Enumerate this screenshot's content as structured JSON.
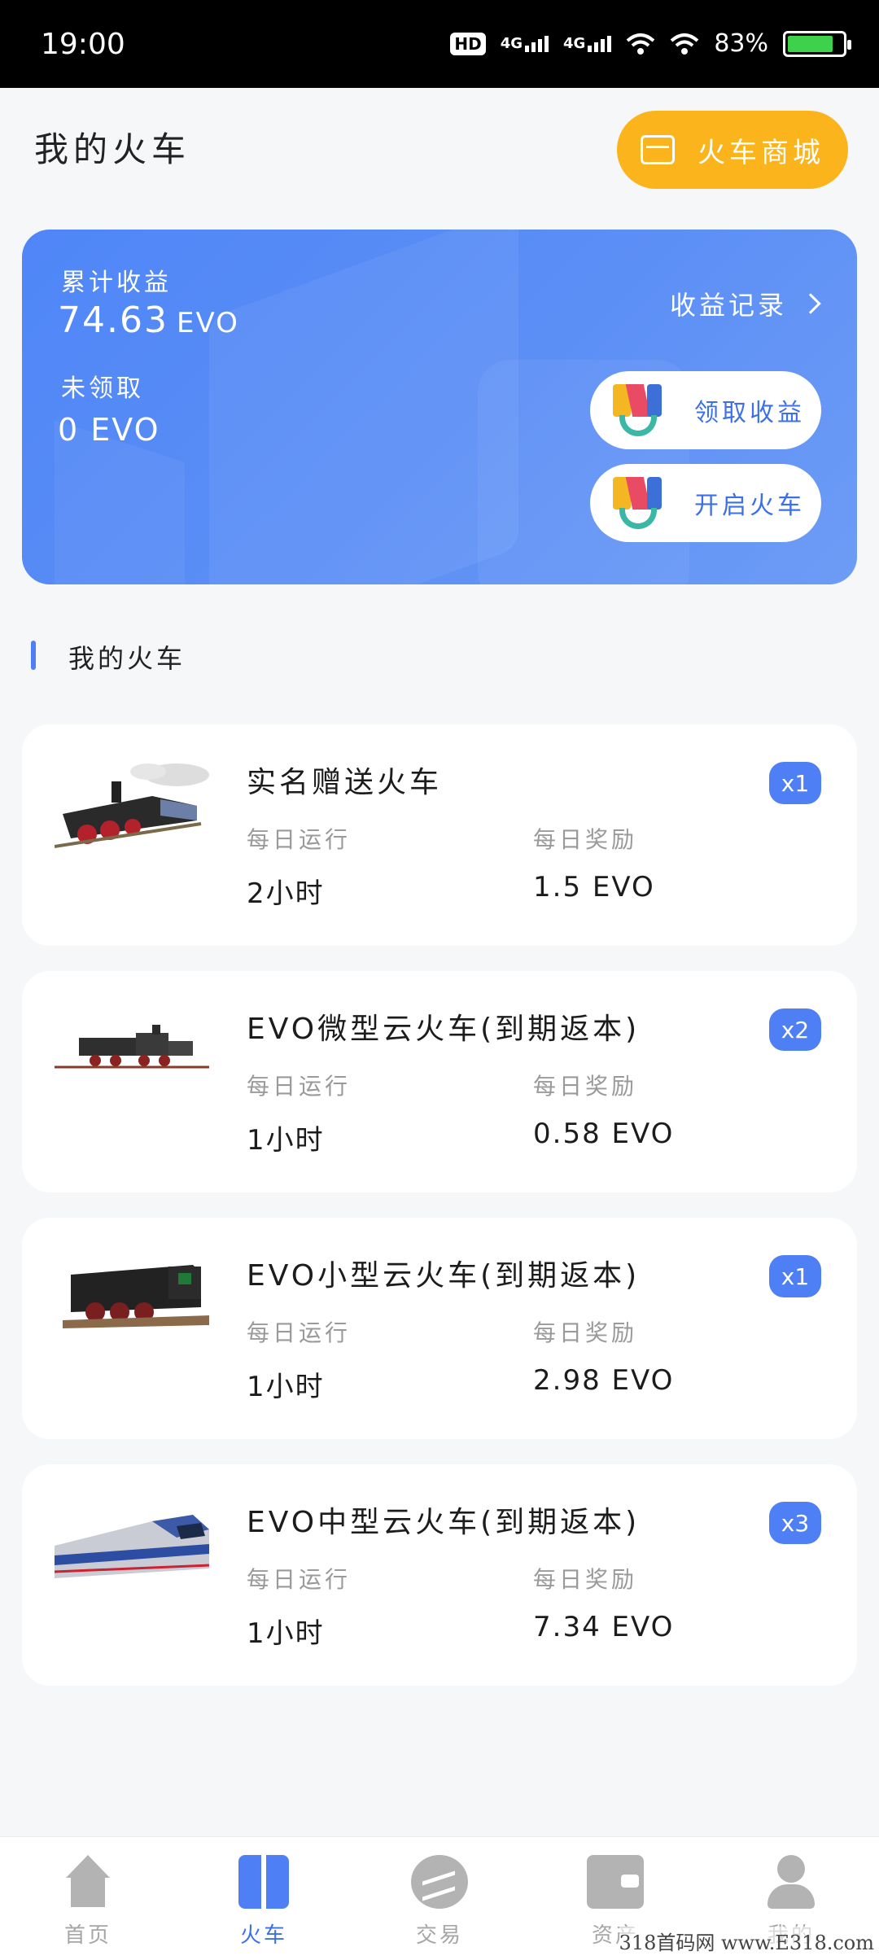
{
  "status_bar": {
    "time": "19:00",
    "hd": "HD",
    "net1": "4G",
    "net2": "4G",
    "battery": "83%"
  },
  "header": {
    "title": "我的火车",
    "shop_button": "火车商城"
  },
  "earnings": {
    "cumulative_label": "累计收益",
    "cumulative_value": "74.63",
    "cumulative_unit": "EVO",
    "unclaimed_label": "未领取",
    "unclaimed_value": "0 EVO",
    "records_link": "收益记录",
    "claim_button": "领取收益",
    "start_button": "开启火车"
  },
  "section": {
    "title": "我的火车"
  },
  "trains": [
    {
      "name": "实名赠送火车",
      "count": "x1",
      "run_label": "每日运行",
      "run_value": "2小时",
      "reward_label": "每日奖励",
      "reward_value": "1.5 EVO"
    },
    {
      "name": "EVO微型云火车(到期返本)",
      "count": "x2",
      "run_label": "每日运行",
      "run_value": "1小时",
      "reward_label": "每日奖励",
      "reward_value": "0.58 EVO"
    },
    {
      "name": "EVO小型云火车(到期返本)",
      "count": "x1",
      "run_label": "每日运行",
      "run_value": "1小时",
      "reward_label": "每日奖励",
      "reward_value": "2.98 EVO"
    },
    {
      "name": "EVO中型云火车(到期返本)",
      "count": "x3",
      "run_label": "每日运行",
      "run_value": "1小时",
      "reward_label": "每日奖励",
      "reward_value": "7.34 EVO"
    }
  ],
  "nav": {
    "items": [
      {
        "label": "首页",
        "icon": "home-icon"
      },
      {
        "label": "火车",
        "icon": "train-icon"
      },
      {
        "label": "交易",
        "icon": "trade-icon"
      },
      {
        "label": "资产",
        "icon": "wallet-icon"
      },
      {
        "label": "我的",
        "icon": "user-icon"
      }
    ],
    "active": "火车"
  },
  "watermark": "318首码网 www.E318.com",
  "colors": {
    "accent": "#4f7ff4",
    "shop": "#fbb41c",
    "card_gradient_start": "#4f86f7"
  }
}
